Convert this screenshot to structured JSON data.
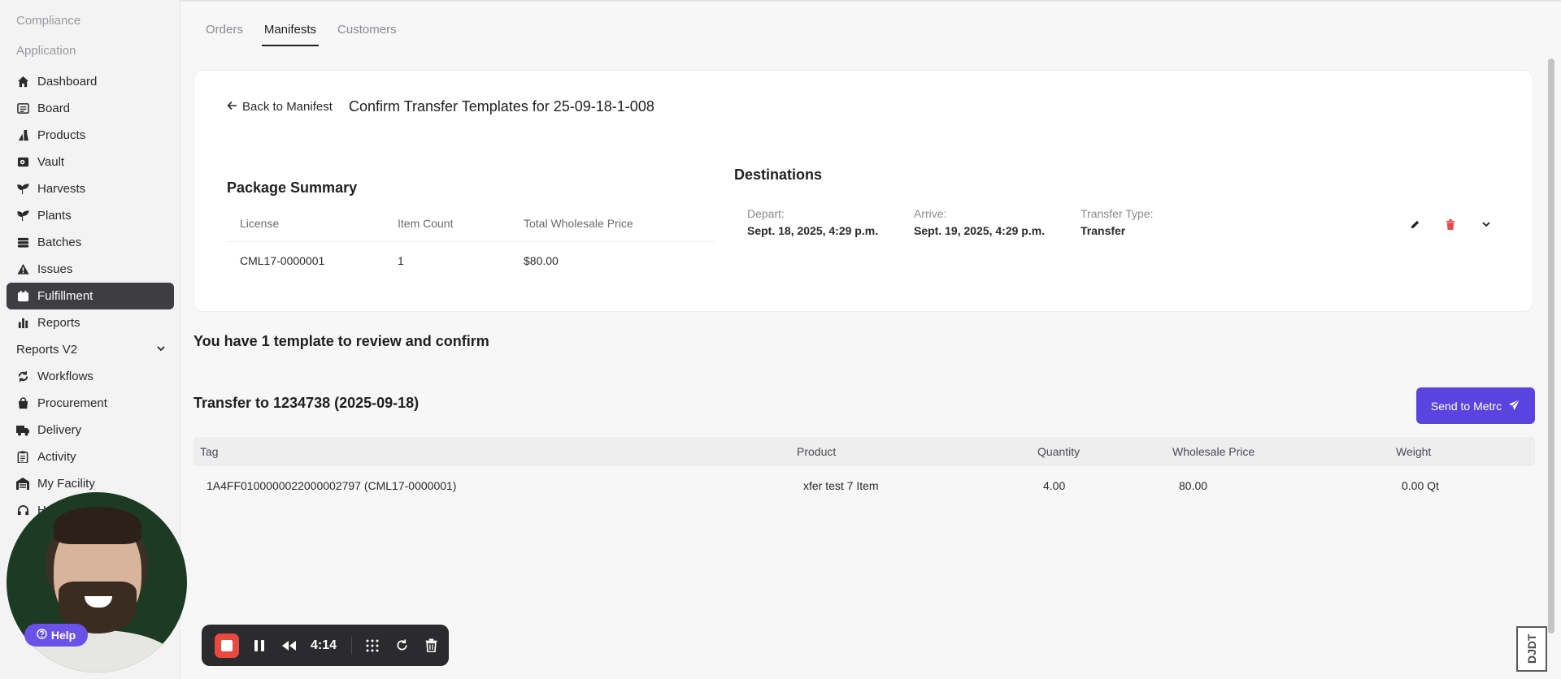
{
  "sidebar": {
    "section_compliance": "Compliance",
    "section_application": "Application",
    "items": [
      {
        "label": "Dashboard",
        "icon": "home-icon"
      },
      {
        "label": "Board",
        "icon": "board-icon"
      },
      {
        "label": "Products",
        "icon": "flask-icon"
      },
      {
        "label": "Vault",
        "icon": "vault-icon"
      },
      {
        "label": "Harvests",
        "icon": "sprout-icon"
      },
      {
        "label": "Plants",
        "icon": "sprout-icon"
      },
      {
        "label": "Batches",
        "icon": "batches-icon"
      },
      {
        "label": "Issues",
        "icon": "warning-icon"
      },
      {
        "label": "Fulfillment",
        "icon": "calendar-icon"
      },
      {
        "label": "Reports",
        "icon": "bar-chart-icon"
      },
      {
        "label": "Reports V2",
        "icon": "chevron-down-icon"
      },
      {
        "label": "Workflows",
        "icon": "workflow-icon"
      },
      {
        "label": "Procurement",
        "icon": "bag-icon"
      },
      {
        "label": "Delivery",
        "icon": "truck-icon"
      },
      {
        "label": "Activity",
        "icon": "clipboard-icon"
      },
      {
        "label": "My Facility",
        "icon": "warehouse-icon"
      },
      {
        "label": "He",
        "icon": "headset-icon"
      }
    ],
    "active": "Fulfillment"
  },
  "tabs": [
    "Orders",
    "Manifests",
    "Customers"
  ],
  "active_tab": "Manifests",
  "card": {
    "back_label": "Back to Manifest",
    "title": "Confirm Transfer Templates for 25-09-18-1-008",
    "package_summary": {
      "title": "Package Summary",
      "headers": [
        "License",
        "Item Count",
        "Total Wholesale Price"
      ],
      "row": [
        "CML17-0000001",
        "1",
        "$80.00"
      ]
    },
    "destinations": {
      "title": "Destinations",
      "depart_label": "Depart:",
      "depart_value": "Sept. 18, 2025, 4:29 p.m.",
      "arrive_label": "Arrive:",
      "arrive_value": "Sept. 19, 2025, 4:29 p.m.",
      "type_label": "Transfer Type:",
      "type_value": "Transfer"
    }
  },
  "review_text": "You have 1 template to review and confirm",
  "transfer_title": "Transfer to 1234738 (2025-09-18)",
  "send_button": "Send to Metrc",
  "table": {
    "headers": [
      "Tag",
      "Product",
      "Quantity",
      "Wholesale Price",
      "Weight"
    ],
    "rows": [
      [
        "1A4FF0100000022000002797 (CML17-0000001)",
        "xfer test 7 Item",
        "4.00",
        "80.00",
        "0.00 Qt"
      ]
    ]
  },
  "recorder": {
    "time": "4:14"
  },
  "help_label": "Help",
  "corner_logo": "DJDT",
  "colors": {
    "accent": "#5b43e0",
    "active_nav": "#3e3e42",
    "record": "#e84a3f",
    "delete": "#e5484d"
  }
}
